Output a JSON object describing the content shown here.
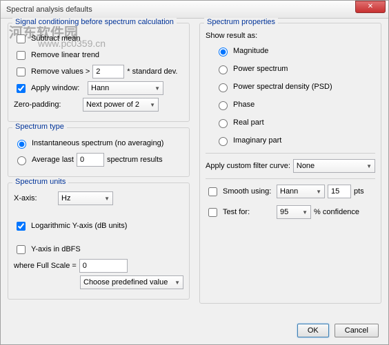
{
  "window": {
    "title": "Spectral analysis defaults"
  },
  "signal": {
    "legend": "Signal conditioning before spectrum calculation",
    "subtract_mean": "Subtract mean",
    "remove_linear": "Remove linear trend",
    "remove_values_gt": "Remove values >",
    "remove_values_val": "2",
    "std_dev": "* standard dev.",
    "apply_window": "Apply window:",
    "window_type": "Hann",
    "zero_padding": "Zero-padding:",
    "zero_padding_val": "Next power of 2"
  },
  "spectrum_type": {
    "legend": "Spectrum type",
    "instantaneous": "Instantaneous spectrum (no averaging)",
    "average_last": "Average last",
    "average_val": "0",
    "spectrum_results": "spectrum results"
  },
  "spectrum_units": {
    "legend": "Spectrum units",
    "xaxis": "X-axis:",
    "xaxis_val": "Hz",
    "log_y": "Logarithmic Y-axis (dB units)",
    "y_dbfs": "Y-axis in dBFS",
    "where_fs": "where Full Scale =",
    "fs_val": "0",
    "choose_btn": "Choose predefined value"
  },
  "props": {
    "legend": "Spectrum properties",
    "show_as": "Show result as:",
    "magnitude": "Magnitude",
    "power_spectrum": "Power spectrum",
    "psd": "Power spectral density (PSD)",
    "phase": "Phase",
    "real": "Real part",
    "imag": "Imaginary part",
    "filter_curve": "Apply custom filter curve:",
    "filter_val": "None",
    "smooth": "Smooth using:",
    "smooth_type": "Hann",
    "smooth_pts": "15",
    "pts": "pts",
    "test_for": "Test for:",
    "conf_val": "95",
    "conf": "%  confidence"
  },
  "footer": {
    "ok": "OK",
    "cancel": "Cancel"
  },
  "watermark": {
    "line1": "河东软件园",
    "line2": "www.pc0359.cn"
  }
}
